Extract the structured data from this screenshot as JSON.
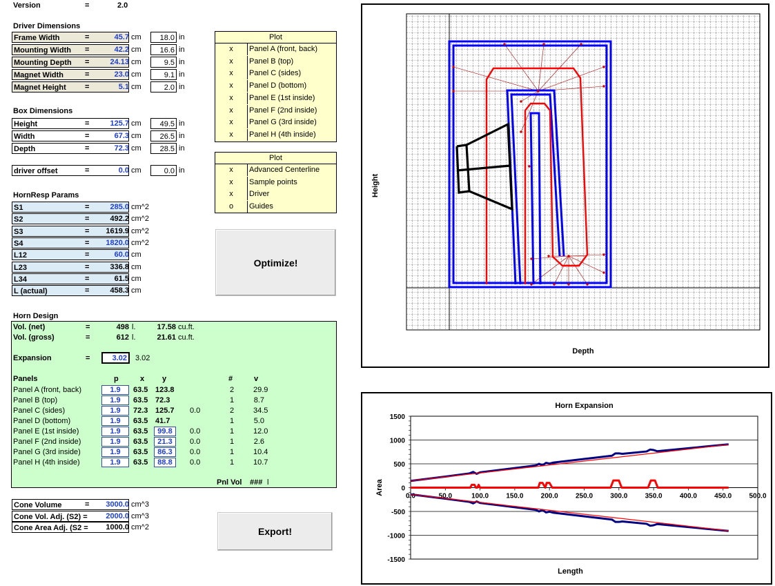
{
  "version": {
    "label": "Version",
    "value": "2.0"
  },
  "driver": {
    "heading": "Driver Dimensions",
    "rows": [
      {
        "name": "Frame Width",
        "cm": "45.7",
        "in": "18.0"
      },
      {
        "name": "Mounting Width",
        "cm": "42.2",
        "in": "16.6"
      },
      {
        "name": "Mounting Depth",
        "cm": "24.13",
        "in": "9.5"
      },
      {
        "name": "Magnet Width",
        "cm": "23.0",
        "in": "9.1"
      },
      {
        "name": "Magnet Height",
        "cm": "5.1",
        "in": "2.0"
      }
    ]
  },
  "box": {
    "heading": "Box Dimensions",
    "rows": [
      {
        "name": "Height",
        "cm": "125.7",
        "in": "49.5"
      },
      {
        "name": "Width",
        "cm": "67.3",
        "in": "26.5"
      },
      {
        "name": "Depth",
        "cm": "72.3",
        "in": "28.5"
      }
    ]
  },
  "offset": {
    "name": "driver offset",
    "cm": "0.0",
    "in": "0.0"
  },
  "hornresp": {
    "heading": "HornResp Params",
    "rows": [
      {
        "name": "S1",
        "val": "285.0",
        "unit": "cm^2",
        "blue": true
      },
      {
        "name": "S2",
        "val": "492.2",
        "unit": "cm^2",
        "blue": false
      },
      {
        "name": "S3",
        "val": "1619.9",
        "unit": "cm^2",
        "blue": false
      },
      {
        "name": "S4",
        "val": "1820.0",
        "unit": "cm^2",
        "blue": true
      },
      {
        "name": "L12",
        "val": "60.0",
        "unit": "cm",
        "blue": true
      },
      {
        "name": "L23",
        "val": "336.8",
        "unit": "cm",
        "blue": false
      },
      {
        "name": "L34",
        "val": "61.5",
        "unit": "cm",
        "blue": false
      },
      {
        "name": "L (actual)",
        "val": "458.3",
        "unit": "cm",
        "blue": false
      }
    ]
  },
  "eq": "=",
  "units": {
    "cm": "cm",
    "in": "in"
  },
  "horn": {
    "heading": "Horn Design",
    "vol_net": {
      "label": "Vol. (net)",
      "l": "498",
      "lu": "l.",
      "cf": "17.58",
      "cfu": "cu.ft."
    },
    "vol_gross": {
      "label": "Vol. (gross)",
      "l": "612",
      "lu": "l.",
      "cf": "21.61",
      "cfu": "cu.ft."
    },
    "expansion": {
      "label": "Expansion",
      "value": "3.02",
      "value2": "3.02"
    },
    "panels_header": {
      "panels": "Panels",
      "p": "p",
      "x": "x",
      "y": "y",
      "n": "#",
      "v": "v"
    },
    "panels": [
      {
        "name": "Panel A (front, back)",
        "p": "1.9",
        "x": "63.5",
        "y": "123.8",
        "yin": false,
        "z": "",
        "n": "2",
        "v": "29.9"
      },
      {
        "name": "Panel B (top)",
        "p": "1.9",
        "x": "63.5",
        "y": "72.3",
        "yin": false,
        "z": "",
        "n": "1",
        "v": "8.7"
      },
      {
        "name": "Panel C (sides)",
        "p": "1.9",
        "x": "72.3",
        "y": "125.7",
        "yin": false,
        "z": "0.0",
        "n": "2",
        "v": "34.5"
      },
      {
        "name": "Panel D (bottom)",
        "p": "1.9",
        "x": "63.5",
        "y": "41.7",
        "yin": false,
        "z": "",
        "n": "1",
        "v": "5.0"
      },
      {
        "name": "Panel E (1st inside)",
        "p": "1.9",
        "x": "63.5",
        "y": "99.8",
        "yin": true,
        "z": "0.0",
        "n": "1",
        "v": "12.0"
      },
      {
        "name": "Panel F (2nd inside)",
        "p": "1.9",
        "x": "63.5",
        "y": "21.3",
        "yin": true,
        "z": "0.0",
        "n": "1",
        "v": "2.6"
      },
      {
        "name": "Panel G (3rd inside)",
        "p": "1.9",
        "x": "63.5",
        "y": "86.3",
        "yin": true,
        "z": "0.0",
        "n": "1",
        "v": "10.4"
      },
      {
        "name": "Panel H (4th inside)",
        "p": "1.9",
        "x": "63.5",
        "y": "88.8",
        "yin": true,
        "z": "0.0",
        "n": "1",
        "v": "10.7"
      }
    ],
    "pnlvol": {
      "label": "Pnl Vol",
      "value": "###",
      "unit": "l"
    }
  },
  "cone": [
    {
      "name": "Cone Volume",
      "val": "3000.0",
      "unit": "cm^3"
    },
    {
      "name": "Cone Vol. Adj. (S2) =",
      "val": "2000.0",
      "unit": "cm^3"
    },
    {
      "name": "Cone Area Adj. (S2 =",
      "val": "1000.0",
      "unit": "cm^2"
    }
  ],
  "plot1": {
    "header": "Plot",
    "rows": [
      {
        "mark": "x",
        "label": "Panel A (front, back)"
      },
      {
        "mark": "x",
        "label": "Panel B (top)"
      },
      {
        "mark": "x",
        "label": "Panel C (sides)"
      },
      {
        "mark": "x",
        "label": "Panel D (bottom)"
      },
      {
        "mark": "x",
        "label": "Panel E (1st inside)"
      },
      {
        "mark": "x",
        "label": "Panel F (2nd inside)"
      },
      {
        "mark": "x",
        "label": "Panel G (3rd inside)"
      },
      {
        "mark": "x",
        "label": "Panel H (4th inside)"
      }
    ]
  },
  "plot2": {
    "header": "Plot",
    "rows": [
      {
        "mark": "x",
        "label": "Advanced Centerline"
      },
      {
        "mark": "x",
        "label": "Sample points"
      },
      {
        "mark": "x",
        "label": "Driver"
      },
      {
        "mark": "o",
        "label": "Guides"
      }
    ]
  },
  "buttons": {
    "optimize": "Optimize!",
    "export": "Export!"
  },
  "colors": {
    "red": "#ff0000",
    "blue": "#0000ff",
    "navy": "#000080",
    "green_panel": "#ccffcc",
    "yellow_panel": "#ffffcc"
  },
  "box_plot": {
    "xlabel": "Depth",
    "ylabel": "Height"
  },
  "chart_data": {
    "type": "line",
    "title": "Horn Expansion",
    "xlabel": "Length",
    "ylabel": "Area",
    "xlim": [
      0,
      500
    ],
    "ylim": [
      -1500,
      1500
    ],
    "xticks": [
      "0.0",
      "50.0",
      "100.0",
      "150.0",
      "200.0",
      "250.0",
      "300.0",
      "350.0",
      "400.0",
      "450.0",
      "500.0"
    ],
    "yticks": [
      "1500",
      "1000",
      "500",
      "0",
      "-500",
      "-1000",
      "-1500"
    ],
    "grid": true,
    "series": [
      {
        "key": "upper-profile",
        "color": "#000080",
        "x": [
          0,
          50,
          85,
          90,
          95,
          100,
          180,
          185,
          190,
          195,
          200,
          205,
          290,
          295,
          300,
          305,
          340,
          345,
          350,
          355,
          458
        ],
        "y": [
          142,
          232,
          300,
          330,
          290,
          320,
          465,
          500,
          470,
          520,
          505,
          525,
          670,
          720,
          720,
          710,
          760,
          800,
          790,
          765,
          910
        ]
      },
      {
        "key": "upper-fit",
        "color": "#ff0000",
        "x": [
          0,
          458
        ],
        "y": [
          142,
          905
        ]
      },
      {
        "key": "lower-profile",
        "color": "#000080",
        "x": [
          0,
          50,
          85,
          90,
          95,
          100,
          180,
          185,
          190,
          195,
          200,
          205,
          290,
          295,
          300,
          305,
          340,
          345,
          350,
          355,
          458
        ],
        "y": [
          -142,
          -232,
          -300,
          -330,
          -290,
          -320,
          -465,
          -500,
          -470,
          -520,
          -505,
          -525,
          -670,
          -720,
          -720,
          -710,
          -760,
          -800,
          -790,
          -765,
          -910
        ]
      },
      {
        "key": "lower-fit",
        "color": "#ff0000",
        "x": [
          0,
          458
        ],
        "y": [
          -142,
          -905
        ]
      },
      {
        "key": "difference",
        "color": "#ff0000",
        "x": [
          0,
          86,
          88,
          92,
          94,
          96,
          98,
          100,
          184,
          186,
          190,
          194,
          196,
          200,
          204,
          288,
          292,
          300,
          304,
          308,
          342,
          346,
          352,
          356,
          458
        ],
        "y": [
          0,
          0,
          60,
          60,
          0,
          0,
          60,
          0,
          0,
          100,
          100,
          0,
          100,
          100,
          0,
          0,
          150,
          150,
          0,
          0,
          0,
          150,
          150,
          0,
          0
        ]
      }
    ]
  }
}
